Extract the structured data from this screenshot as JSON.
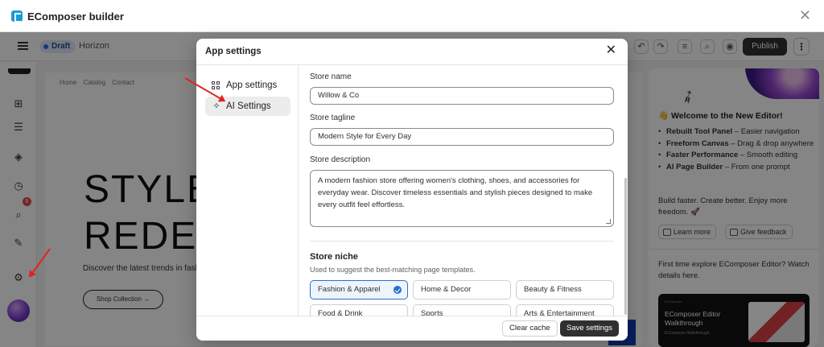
{
  "window": {
    "title": "EComposer builder",
    "close_icon": "close-icon"
  },
  "toolbar": {
    "status": "Draft",
    "theme": "Horizon",
    "publish": "Publish"
  },
  "canvas": {
    "nav": "Home  Catalog  Contact",
    "hero_line1": "STYLE",
    "hero_line2": "REDEFI",
    "subtitle": "Discover the latest trends in fash",
    "cta": "Shop Collection"
  },
  "left_rail": {
    "badge": "6"
  },
  "right_panel": {
    "title": "👋 Welcome to the New Editor!",
    "features": [
      {
        "name": "Rebuilt Tool Panel",
        "desc": " – Easier navigation"
      },
      {
        "name": "Freeform Canvas",
        "desc": " – Drag & drop anywhere"
      },
      {
        "name": "Faster Performance",
        "desc": " – Smooth editing"
      },
      {
        "name": "AI Page Builder",
        "desc": " – From one prompt"
      }
    ],
    "tagline": "Build faster. Create better. Enjoy more freedom. 🚀",
    "learn_more": "Learn more",
    "give_feedback": "Give feedback",
    "first_time": "First time explore EComposer Editor? Watch details here.",
    "video_brand": "EComposer",
    "video_title": "EComposer Editor Walkthrough",
    "video_sub": "EComposer Walkthrough"
  },
  "modal": {
    "title": "App settings",
    "nav": [
      {
        "label": "App settings",
        "icon": "grid-settings-icon"
      },
      {
        "label": "AI Settings",
        "icon": "sparkles-icon"
      }
    ],
    "fields": {
      "store_name_label": "Store name",
      "store_name_value": "Willow & Co",
      "store_tagline_label": "Store tagline",
      "store_tagline_value": "Modern Style for Every Day",
      "store_description_label": "Store description",
      "store_description_value": "A modern fashion store offering women's clothing, shoes, and accessories for everyday wear. Discover timeless essentials and stylish pieces designed to make every outfit feel effortless."
    },
    "niche": {
      "title": "Store niche",
      "help": "Used to suggest the best-matching page templates.",
      "options": [
        "Fashion & Apparel",
        "Home & Decor",
        "Beauty & Fitness",
        "Food & Drink",
        "Sports",
        "Arts & Entertainment"
      ],
      "selected": "Fashion & Apparel"
    },
    "footer": {
      "clear_cache": "Clear cache",
      "save": "Save settings"
    }
  },
  "colors": {
    "accent": "#2c6ecb",
    "primary_button": "#303030",
    "annotation_arrow": "#e02424"
  }
}
